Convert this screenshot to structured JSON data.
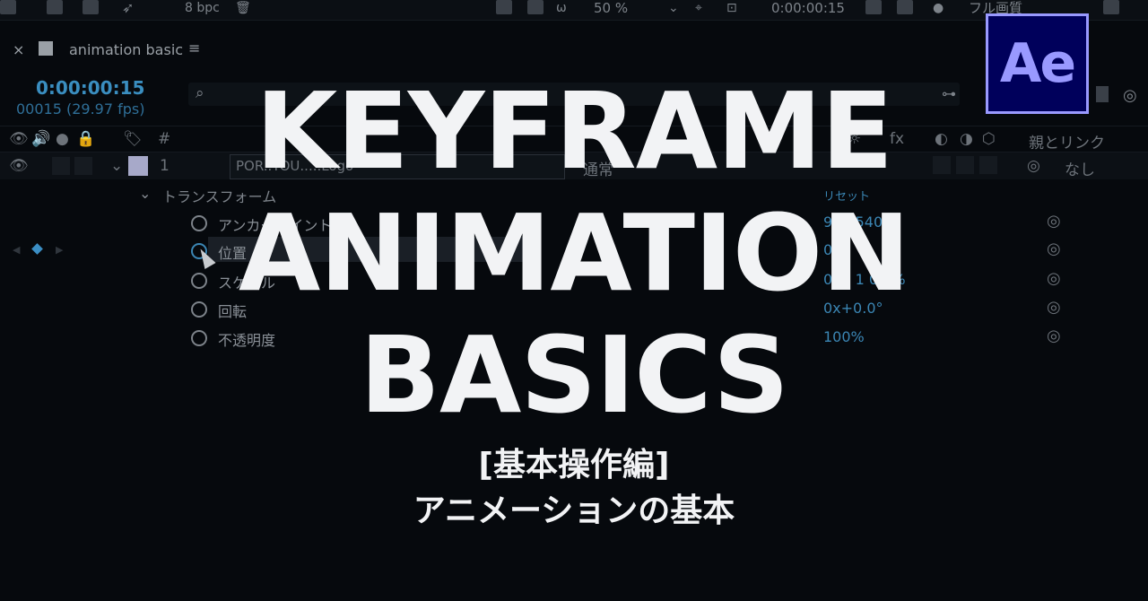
{
  "toolbar": {
    "bit_depth": "8 bpc",
    "zoom": "50 %",
    "timecode": "0:00:00:15",
    "quality": "フル画質"
  },
  "comp_panel": {
    "tab_name": "animation basic",
    "current_time": "0:00:00:15",
    "frame_info": "00015 (29.97 fps)"
  },
  "layer_header": {
    "number_symbol": "#",
    "parent_label": "親とリンク"
  },
  "layer": {
    "index": "1",
    "name": "POR..YOU.....Logo",
    "mode": "通常",
    "parent": "なし"
  },
  "transform": {
    "group_label": "トランスフォーム",
    "reset_label": "リセット",
    "properties": [
      {
        "label": "アンカーポイント",
        "value": "960,540."
      },
      {
        "label": "位置",
        "value": "0,5"
      },
      {
        "label": "スケール",
        "value": "0.0, 1  0.0%"
      },
      {
        "label": "回転",
        "value": "0x+0.0°"
      },
      {
        "label": "不透明度",
        "value": "100%"
      }
    ]
  },
  "logo": {
    "text": "Ae"
  },
  "overlay": {
    "title_lines": [
      "KEYFRAME",
      "ANIMATION",
      "BASICS"
    ],
    "subtitle": "[基本操作編]",
    "subtitle2": "アニメーションの基本"
  },
  "colors": {
    "background": "#06090d",
    "accent_blue": "#3b86b4",
    "ae_purple": "#9999ff",
    "ae_navy": "#00005b",
    "title_white": "#f2f3f5"
  }
}
